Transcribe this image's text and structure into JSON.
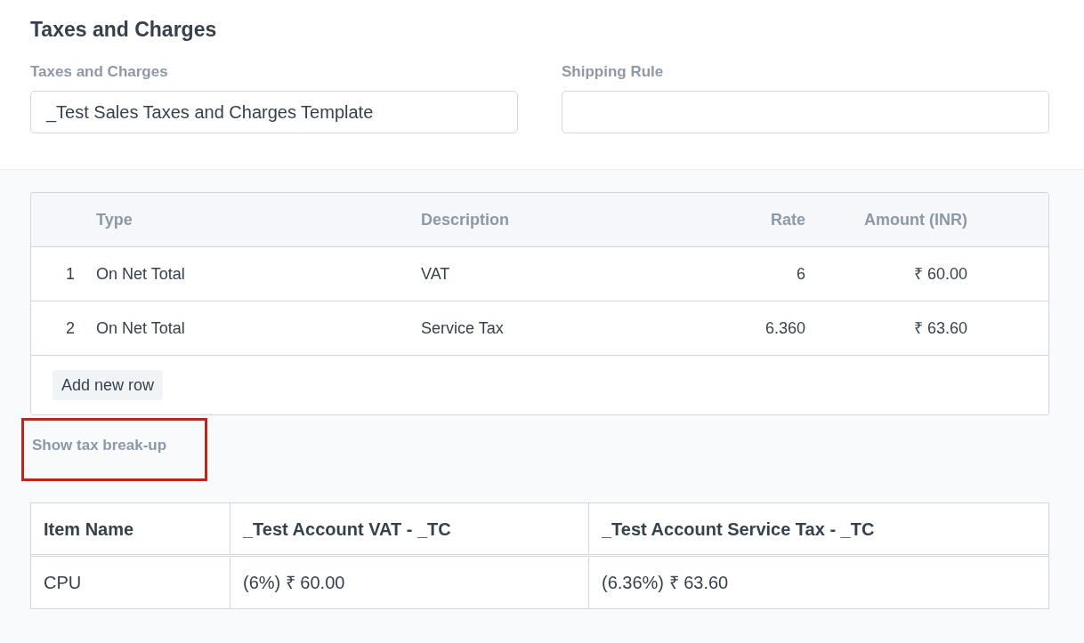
{
  "section_title": "Taxes and Charges",
  "fields": [
    {
      "label": "Taxes and Charges",
      "value": "_Test Sales Taxes and Charges Template"
    },
    {
      "label": "Shipping Rule"
    }
  ],
  "taxes_table": {
    "columns": [
      "Type",
      "Description",
      "Rate",
      "Amount (INR)"
    ],
    "rows": [
      {
        "index": "1",
        "cells": [
          "On Net Total",
          "VAT",
          "6",
          "₹ 60.00"
        ]
      },
      {
        "index": "2",
        "cells": [
          "On Net Total",
          "Service Tax",
          "6.360",
          "₹ 63.60"
        ]
      }
    ],
    "add_row_button": "Add new row"
  },
  "breakup_link": {
    "label": "Show tax break-up",
    "highlighted": true
  },
  "breakup_table": {
    "columns": [
      "Item Name",
      "_Test Account VAT - _TC",
      "_Test Account Service Tax - _TC"
    ],
    "rows": [
      [
        "CPU",
        "(6%) ₹ 60.00",
        "(6.36%) ₹ 63.60"
      ]
    ]
  }
}
